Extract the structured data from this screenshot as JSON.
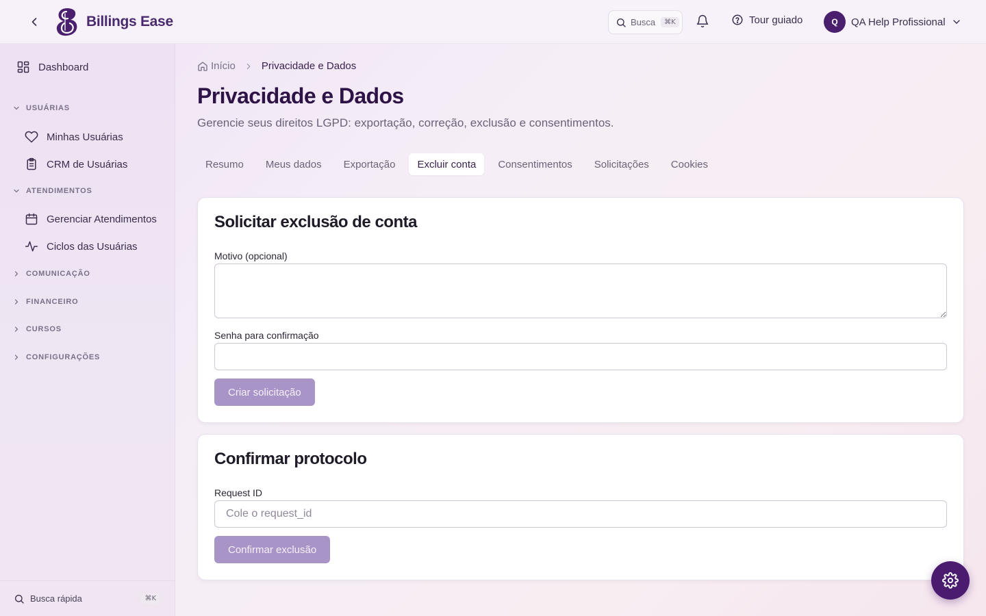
{
  "header": {
    "app_name": "Billings Ease",
    "search_label": "Busca",
    "search_shortcut": "⌘K",
    "tour_label": "Tour guiado",
    "user_initial": "Q",
    "user_name": "QA Help Profissional"
  },
  "sidebar": {
    "dashboard": "Dashboard",
    "sections": [
      {
        "label": "USUÁRIAS",
        "expanded": true,
        "items": [
          "Minhas Usuárias",
          "CRM de Usuárias"
        ]
      },
      {
        "label": "ATENDIMENTOS",
        "expanded": true,
        "items": [
          "Gerenciar Atendimentos",
          "Ciclos das Usuárias"
        ]
      },
      {
        "label": "COMUNICAÇÃO",
        "expanded": false
      },
      {
        "label": "FINANCEIRO",
        "expanded": false
      },
      {
        "label": "CURSOS",
        "expanded": false
      },
      {
        "label": "CONFIGURAÇÕES",
        "expanded": false
      }
    ],
    "quick_search": "Busca rápida",
    "quick_search_shortcut": "⌘K"
  },
  "breadcrumb": {
    "home": "Início",
    "current": "Privacidade e Dados"
  },
  "page": {
    "title": "Privacidade e Dados",
    "subtitle": "Gerencie seus direitos LGPD: exportação, correção, exclusão e consentimentos."
  },
  "tabs": [
    "Resumo",
    "Meus dados",
    "Exportação",
    "Excluir conta",
    "Consentimentos",
    "Solicitações",
    "Cookies"
  ],
  "active_tab": "Excluir conta",
  "delete_card": {
    "title": "Solicitar exclusão de conta",
    "reason_label": "Motivo (opcional)",
    "reason_value": "",
    "password_label": "Senha para confirmação",
    "password_value": "",
    "submit_label": "Criar solicitação"
  },
  "confirm_card": {
    "title": "Confirmar protocolo",
    "request_label": "Request ID",
    "request_placeholder": "Cole o request_id",
    "submit_label": "Confirmar exclusão"
  },
  "colors": {
    "brand": "#4a1f6e",
    "button_disabled": "#a894c6"
  }
}
